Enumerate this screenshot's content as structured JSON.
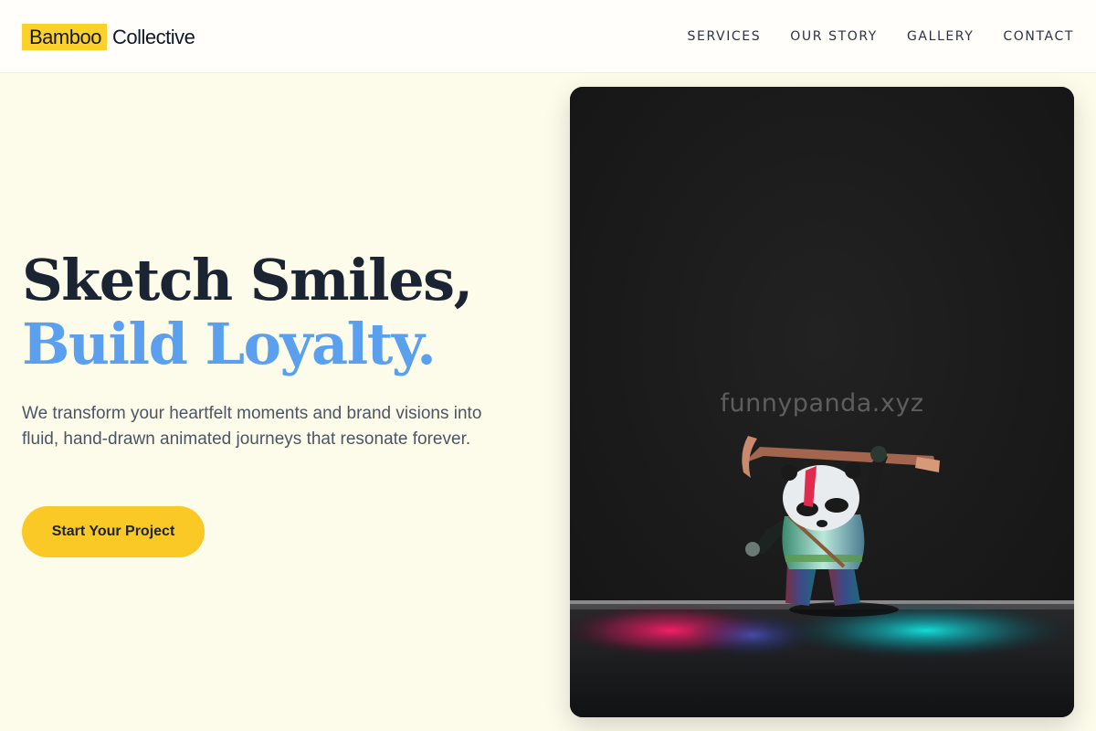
{
  "brand": {
    "highlight": "Bamboo",
    "rest": "Collective",
    "accent_color": "#fcd12a"
  },
  "nav": {
    "items": [
      "SERVICES",
      "OUR STORY",
      "GALLERY",
      "CONTACT"
    ]
  },
  "hero": {
    "title_line1": "Sketch Smiles,",
    "title_line2": "Build Loyalty.",
    "title_line2_color": "#5aa0ee",
    "description": "We transform your heartfelt moments and brand visions into fluid, hand-drawn animated journeys that resonate forever.",
    "cta_label": "Start Your Project",
    "cta_color": "#fac925"
  },
  "image": {
    "watermark": "funnypanda.xyz",
    "subject": "panda-warrior-figurine"
  }
}
